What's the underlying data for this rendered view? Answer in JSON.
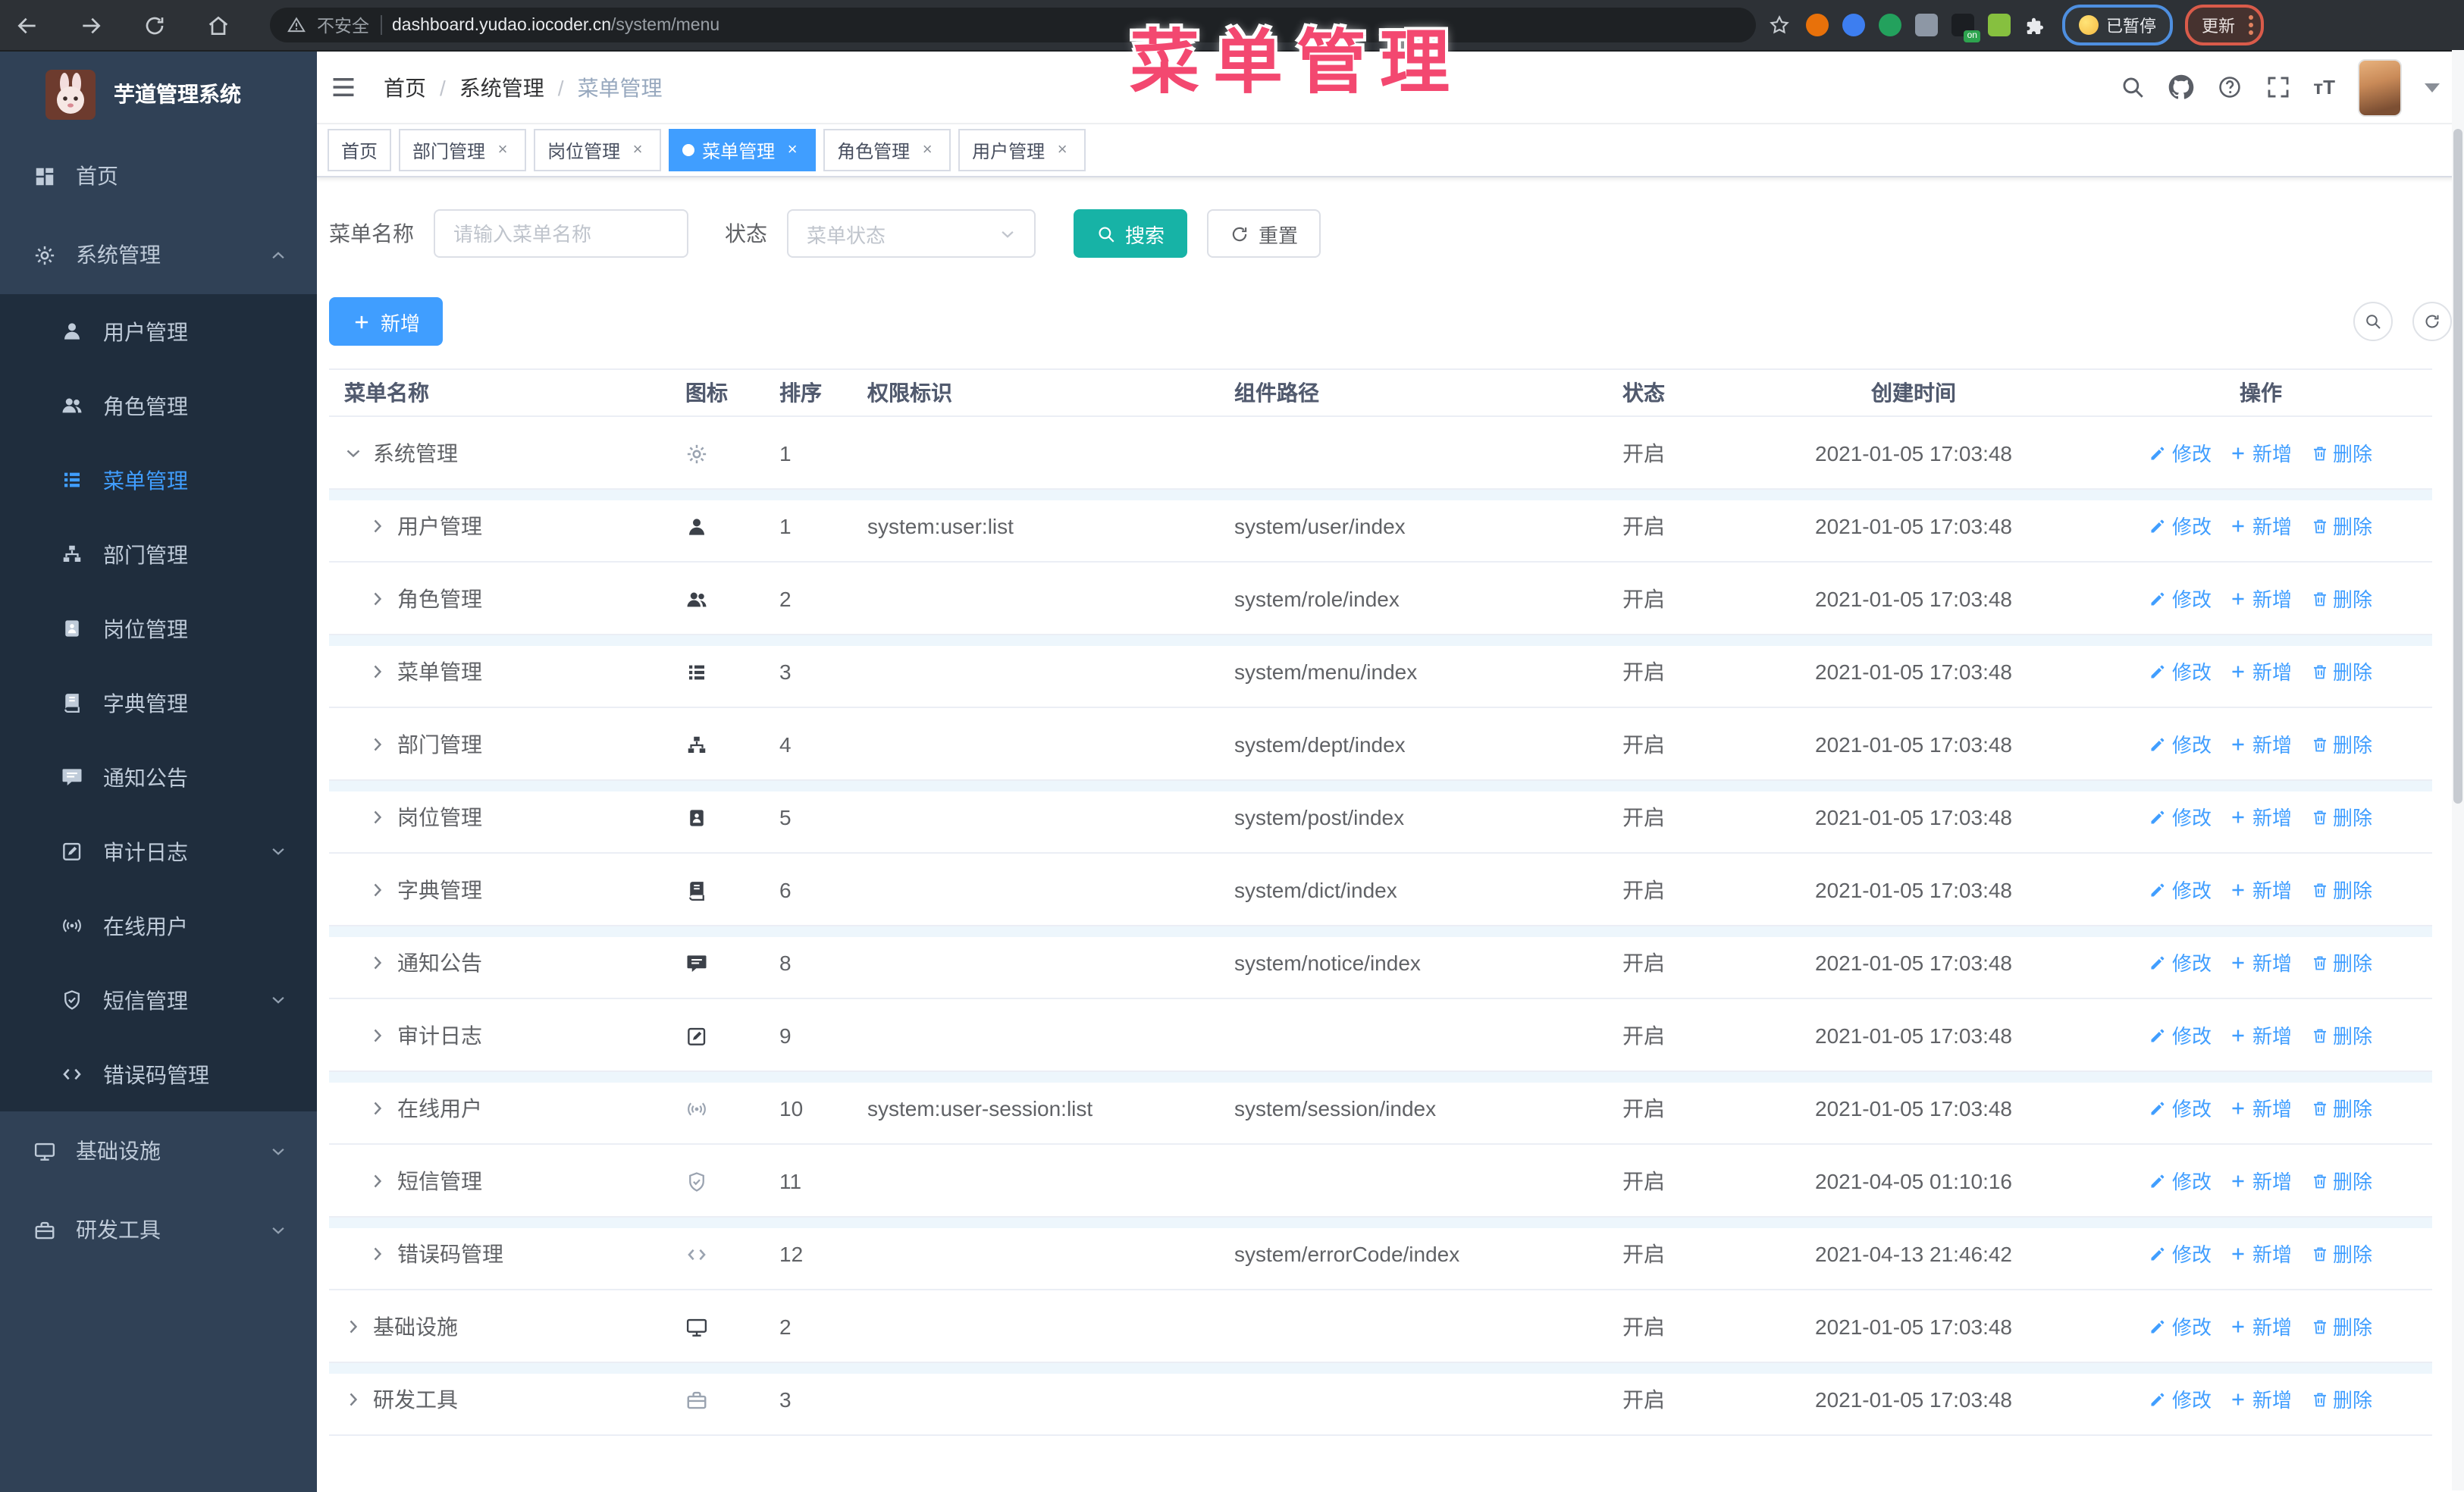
{
  "browser": {
    "nav_icons": [
      "arrow-left",
      "arrow-right",
      "reload",
      "home"
    ],
    "security_label": "不安全",
    "url_host": "dashboard.yudao.iocoder.cn",
    "url_path": "/system/menu",
    "extensions": [
      {
        "name": "extension-orange-circle",
        "color": "#e8710a",
        "shape": "circle"
      },
      {
        "name": "extension-blue-gem",
        "color": "#3d7ef0",
        "shape": "circle"
      },
      {
        "name": "extension-green-check",
        "color": "#23a15d",
        "shape": "circle"
      },
      {
        "name": "extension-gray-blue",
        "color": "#8d97a5",
        "shape": "square"
      },
      {
        "name": "extension-dark-on",
        "color": "#1b1e22",
        "shape": "square",
        "badge": "on"
      },
      {
        "name": "extension-green-bot",
        "color": "#86c03f",
        "shape": "square"
      },
      {
        "name": "extension-puzzle",
        "color": "#e8eaed",
        "shape": "puzzle"
      }
    ],
    "paused_badge": "已暂停",
    "update_badge": "更新"
  },
  "overlay_title": "菜单管理",
  "colors": {
    "accent_blue": "#409eff",
    "search_teal": "#17b3a6",
    "sidebar_bg": "#304156",
    "submenu_bg": "#1f2d3d",
    "active_tab": "#409eff",
    "overlay_pink": "#f34870",
    "link_blue": "#409eff"
  },
  "sidebar": {
    "app_title": "芋道管理系统",
    "items": [
      {
        "label": "首页",
        "icon": "dashboard",
        "level": 0
      },
      {
        "label": "系统管理",
        "icon": "gear",
        "level": 0,
        "chevron": "up"
      },
      {
        "label": "用户管理",
        "icon": "user",
        "level": 1
      },
      {
        "label": "角色管理",
        "icon": "users",
        "level": 1
      },
      {
        "label": "菜单管理",
        "icon": "list",
        "level": 1,
        "active": true
      },
      {
        "label": "部门管理",
        "icon": "tree",
        "level": 1
      },
      {
        "label": "岗位管理",
        "icon": "badge",
        "level": 1
      },
      {
        "label": "字典管理",
        "icon": "book",
        "level": 1
      },
      {
        "label": "通知公告",
        "icon": "message",
        "level": 1
      },
      {
        "label": "审计日志",
        "icon": "edit",
        "level": 1,
        "chevron": "down"
      },
      {
        "label": "在线用户",
        "icon": "online",
        "level": 1
      },
      {
        "label": "短信管理",
        "icon": "shield",
        "level": 1,
        "chevron": "down"
      },
      {
        "label": "错误码管理",
        "icon": "code",
        "level": 1
      },
      {
        "label": "基础设施",
        "icon": "monitor",
        "level": 0,
        "chevron": "down"
      },
      {
        "label": "研发工具",
        "icon": "toolbox",
        "level": 0,
        "chevron": "down"
      }
    ]
  },
  "navbar": {
    "breadcrumb": [
      "首页",
      "系统管理",
      "菜单管理"
    ],
    "right_icons": [
      "search",
      "github",
      "question",
      "fullscreen"
    ],
    "font_size_icon_text": "тT"
  },
  "tabs": [
    {
      "label": "首页"
    },
    {
      "label": "部门管理",
      "closable": true
    },
    {
      "label": "岗位管理",
      "closable": true
    },
    {
      "label": "菜单管理",
      "closable": true,
      "active": true
    },
    {
      "label": "角色管理",
      "closable": true
    },
    {
      "label": "用户管理",
      "closable": true
    }
  ],
  "filters": {
    "name_label": "菜单名称",
    "name_placeholder": "请输入菜单名称",
    "name_value": "",
    "status_label": "状态",
    "status_placeholder": "菜单状态",
    "search_label": "搜索",
    "reset_label": "重置"
  },
  "toolbar": {
    "add_label": "新增"
  },
  "table": {
    "columns": [
      "菜单名称",
      "图标",
      "排序",
      "权限标识",
      "组件路径",
      "状态",
      "创建时间",
      "操作"
    ],
    "op_labels": {
      "edit": "修改",
      "add": "新增",
      "delete": "删除"
    },
    "rows": [
      {
        "name": "系统管理",
        "icon": "gear",
        "icon_tone": "light",
        "level": 0,
        "expanded": true,
        "sort": "1",
        "perm": "",
        "path": "",
        "status": "开启",
        "time": "2021-01-05 17:03:48"
      },
      {
        "name": "用户管理",
        "icon": "user",
        "icon_tone": "dark",
        "level": 1,
        "sort": "1",
        "perm": "system:user:list",
        "path": "system/user/index",
        "status": "开启",
        "time": "2021-01-05 17:03:48"
      },
      {
        "name": "角色管理",
        "icon": "users",
        "icon_tone": "dark",
        "level": 1,
        "sort": "2",
        "perm": "",
        "path": "system/role/index",
        "status": "开启",
        "time": "2021-01-05 17:03:48"
      },
      {
        "name": "菜单管理",
        "icon": "list",
        "icon_tone": "dark",
        "level": 1,
        "sort": "3",
        "perm": "",
        "path": "system/menu/index",
        "status": "开启",
        "time": "2021-01-05 17:03:48"
      },
      {
        "name": "部门管理",
        "icon": "tree",
        "icon_tone": "dark",
        "level": 1,
        "sort": "4",
        "perm": "",
        "path": "system/dept/index",
        "status": "开启",
        "time": "2021-01-05 17:03:48"
      },
      {
        "name": "岗位管理",
        "icon": "badge",
        "icon_tone": "dark",
        "level": 1,
        "sort": "5",
        "perm": "",
        "path": "system/post/index",
        "status": "开启",
        "time": "2021-01-05 17:03:48"
      },
      {
        "name": "字典管理",
        "icon": "book",
        "icon_tone": "dark",
        "level": 1,
        "sort": "6",
        "perm": "",
        "path": "system/dict/index",
        "status": "开启",
        "time": "2021-01-05 17:03:48"
      },
      {
        "name": "通知公告",
        "icon": "message",
        "icon_tone": "dark",
        "level": 1,
        "sort": "8",
        "perm": "",
        "path": "system/notice/index",
        "status": "开启",
        "time": "2021-01-05 17:03:48"
      },
      {
        "name": "审计日志",
        "icon": "edit",
        "icon_tone": "dark",
        "level": 1,
        "sort": "9",
        "perm": "",
        "path": "",
        "status": "开启",
        "time": "2021-01-05 17:03:48"
      },
      {
        "name": "在线用户",
        "icon": "online",
        "icon_tone": "light",
        "level": 1,
        "sort": "10",
        "perm": "system:user-session:list",
        "path": "system/session/index",
        "status": "开启",
        "time": "2021-01-05 17:03:48"
      },
      {
        "name": "短信管理",
        "icon": "shield",
        "icon_tone": "light",
        "level": 1,
        "sort": "11",
        "perm": "",
        "path": "",
        "status": "开启",
        "time": "2021-04-05 01:10:16"
      },
      {
        "name": "错误码管理",
        "icon": "code",
        "icon_tone": "light",
        "level": 1,
        "sort": "12",
        "perm": "",
        "path": "system/errorCode/index",
        "status": "开启",
        "time": "2021-04-13 21:46:42"
      },
      {
        "name": "基础设施",
        "icon": "monitor",
        "icon_tone": "dark",
        "level": 0,
        "sort": "2",
        "perm": "",
        "path": "",
        "status": "开启",
        "time": "2021-01-05 17:03:48"
      },
      {
        "name": "研发工具",
        "icon": "toolbox",
        "icon_tone": "light",
        "level": 0,
        "sort": "3",
        "perm": "",
        "path": "",
        "status": "开启",
        "time": "2021-01-05 17:03:48"
      }
    ]
  }
}
